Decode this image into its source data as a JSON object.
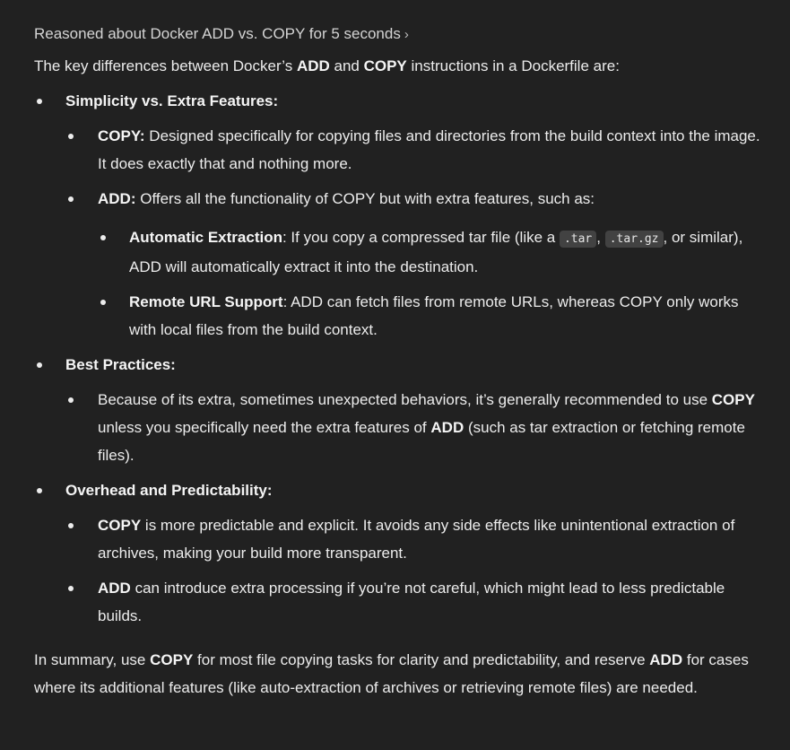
{
  "reasoning": {
    "label": "Reasoned about Docker ADD vs. COPY for 5 seconds",
    "chevron": "›"
  },
  "intro": {
    "pre": "The key differences between Docker’s ",
    "b1": "ADD",
    "mid": " and ",
    "b2": "COPY",
    "post": " instructions in a Dockerfile are:"
  },
  "sections": [
    {
      "title": "Simplicity vs. Extra Features:",
      "copy_item": {
        "label": "COPY:",
        "text": " Designed specifically for copying files and directories from the build context into the image. It does exactly that and nothing more."
      },
      "add_item": {
        "label": "ADD:",
        "text": " Offers all the functionality of COPY but with extra features, such as:",
        "sub": [
          {
            "label": "Automatic Extraction",
            "pre": ": If you copy a compressed tar file (like a ",
            "code1": ".tar",
            "sep": ", ",
            "code2": ".tar.gz",
            "post": ", or similar), ADD will automatically extract it into the destination."
          },
          {
            "label": "Remote URL Support",
            "text": ": ADD can fetch files from remote URLs, whereas COPY only works with local files from the build context."
          }
        ]
      }
    },
    {
      "title": "Best Practices:",
      "item": {
        "pre": "Because of its extra, sometimes unexpected behaviors, it’s generally recommended to use ",
        "b1": "COPY",
        "mid": " unless you specifically need the extra features of ",
        "b2": "ADD",
        "post": " (such as tar extraction or fetching remote files)."
      }
    },
    {
      "title": "Overhead and Predictability:",
      "items": [
        {
          "b": "COPY",
          "text": " is more predictable and explicit. It avoids any side effects like unintentional extraction of archives, making your build more transparent."
        },
        {
          "b": "ADD",
          "text": " can introduce extra processing if you’re not careful, which might lead to less predictable builds."
        }
      ]
    }
  ],
  "summary": {
    "pre": "In summary, use ",
    "b1": "COPY",
    "mid": " for most file copying tasks for clarity and predictability, and reserve ",
    "b2": "ADD",
    "post": " for cases where its additional features (like auto-extraction of archives or retrieving remote files) are needed."
  }
}
